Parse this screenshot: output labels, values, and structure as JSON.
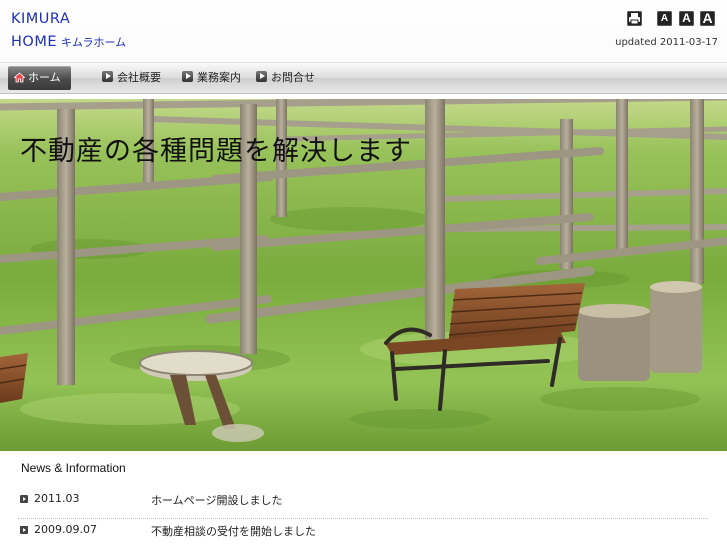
{
  "header": {
    "logo_line1": "KIMURA",
    "logo_line2": "HOME",
    "logo_kana": "キムラホーム",
    "updated": "updated 2011-03-17",
    "print_icon": "printer-icon",
    "font_small_label": "A",
    "font_medium_label": "A",
    "font_large_label": "A"
  },
  "nav": {
    "items": [
      {
        "label": "ホーム",
        "icon": "home-icon",
        "active": true
      },
      {
        "label": "会社概要",
        "icon": "play-icon"
      },
      {
        "label": "業務案内",
        "icon": "play-icon"
      },
      {
        "label": "お問合せ",
        "icon": "play-icon"
      }
    ]
  },
  "hero": {
    "title": "不動産の各種問題を解決します"
  },
  "news": {
    "heading": "News & Information",
    "items": [
      {
        "date": "2011.03",
        "title": "ホームページ開設しました"
      },
      {
        "date": "2009.09.07",
        "title": "不動産相談の受付を開始しました"
      }
    ]
  },
  "colors": {
    "logo": "#1d2fb8",
    "nav_active": "#4a4a4a",
    "grass": "#79a93b"
  }
}
